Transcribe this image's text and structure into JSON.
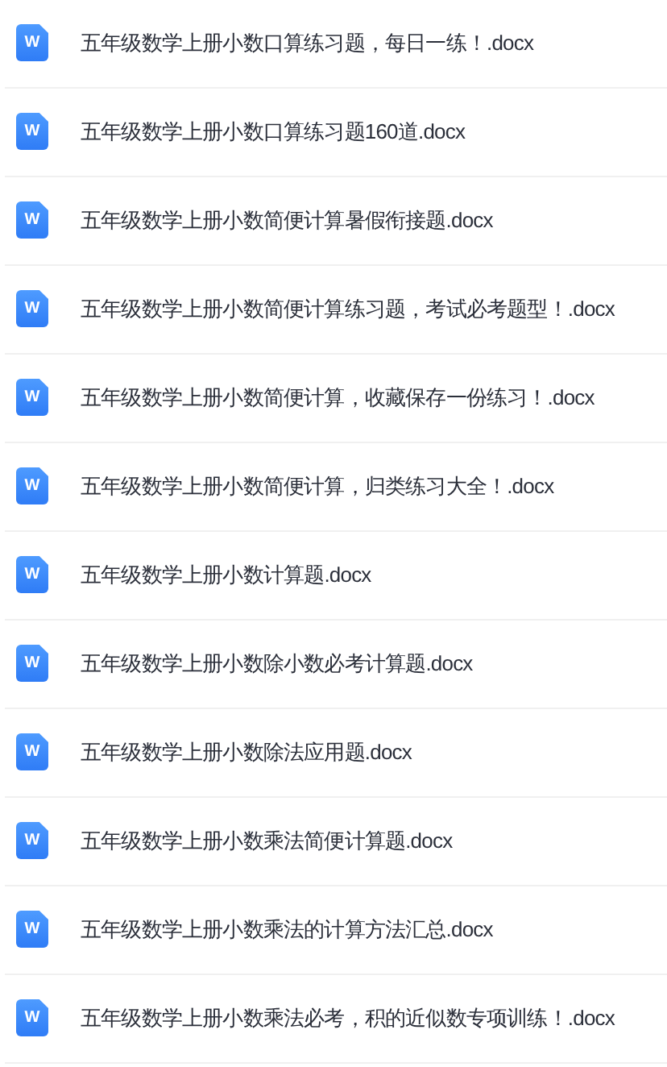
{
  "files": [
    {
      "icon_text": "W",
      "name": "五年级数学上册小数口算练习题，每日一练！.docx"
    },
    {
      "icon_text": "W",
      "name": "五年级数学上册小数口算练习题160道.docx"
    },
    {
      "icon_text": "W",
      "name": "五年级数学上册小数简便计算暑假衔接题.docx"
    },
    {
      "icon_text": "W",
      "name": "五年级数学上册小数简便计算练习题，考试必考题型！.docx"
    },
    {
      "icon_text": "W",
      "name": "五年级数学上册小数简便计算，收藏保存一份练习！.docx"
    },
    {
      "icon_text": "W",
      "name": "五年级数学上册小数简便计算，归类练习大全！.docx"
    },
    {
      "icon_text": "W",
      "name": "五年级数学上册小数计算题.docx"
    },
    {
      "icon_text": "W",
      "name": "五年级数学上册小数除小数必考计算题.docx"
    },
    {
      "icon_text": "W",
      "name": "五年级数学上册小数除法应用题.docx"
    },
    {
      "icon_text": "W",
      "name": "五年级数学上册小数乘法简便计算题.docx"
    },
    {
      "icon_text": "W",
      "name": "五年级数学上册小数乘法的计算方法汇总.docx"
    },
    {
      "icon_text": "W",
      "name": "五年级数学上册小数乘法必考，积的近似数专项训练！.docx"
    }
  ]
}
